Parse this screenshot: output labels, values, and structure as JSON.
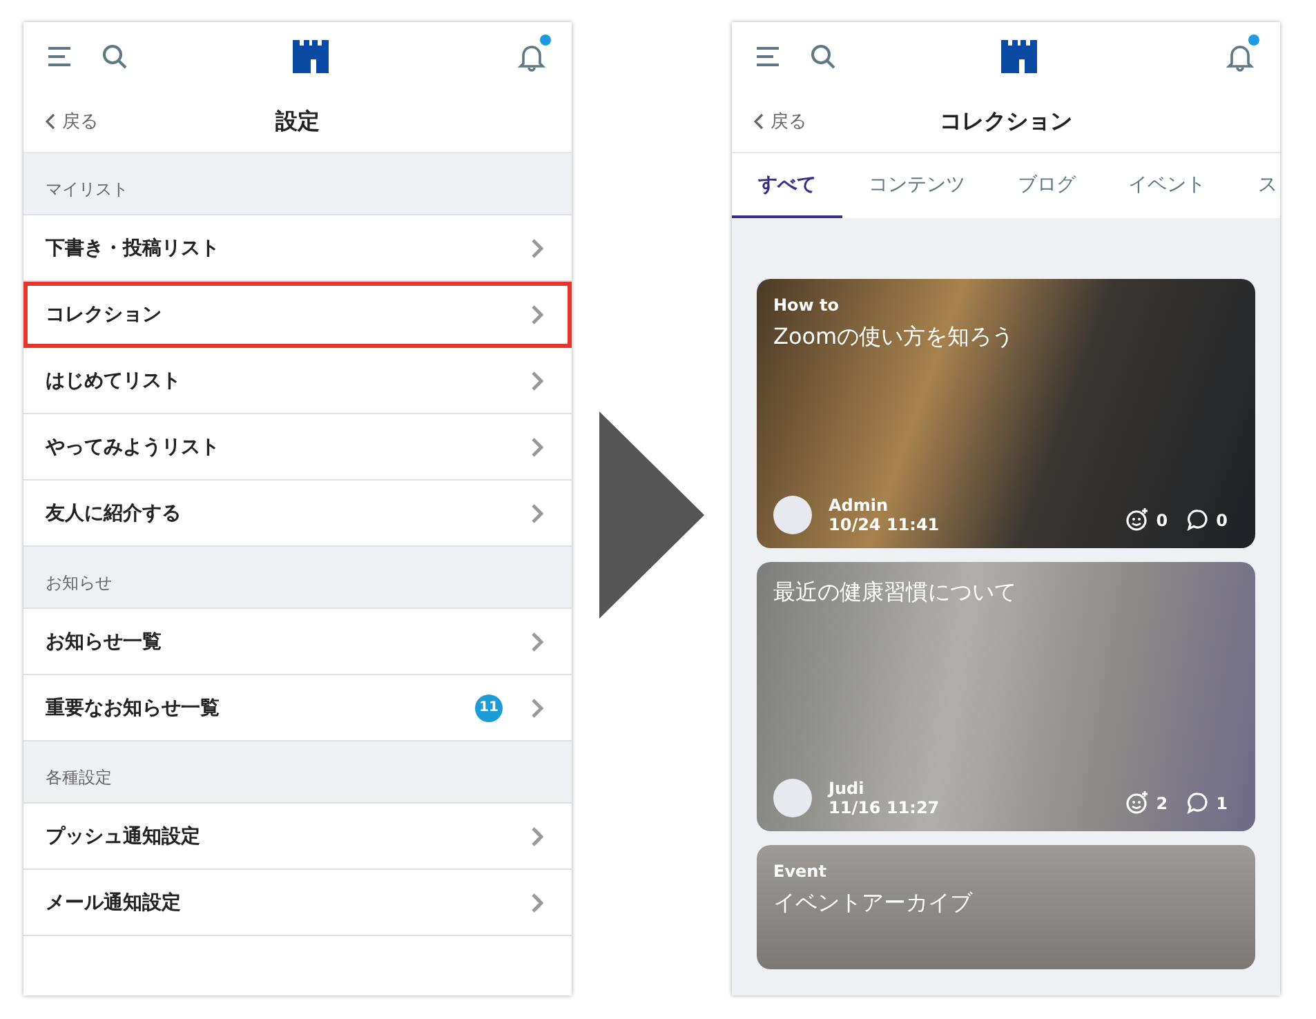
{
  "settings_screen": {
    "header": {
      "has_unread": true
    },
    "back": "戻る",
    "title": "設定",
    "sections": [
      {
        "heading": "マイリスト",
        "items": [
          {
            "label": "下書き・投稿リスト",
            "highlighted": false
          },
          {
            "label": "コレクション",
            "highlighted": true
          },
          {
            "label": "はじめてリスト",
            "highlighted": false
          },
          {
            "label": "やってみようリスト",
            "highlighted": false
          },
          {
            "label": "友人に紹介する",
            "highlighted": false
          }
        ]
      },
      {
        "heading": "お知らせ",
        "items": [
          {
            "label": "お知らせ一覧",
            "highlighted": false
          },
          {
            "label": "重要なお知らせ一覧",
            "highlighted": false,
            "badge": "11"
          }
        ]
      },
      {
        "heading": "各種設定",
        "items": [
          {
            "label": "プッシュ通知設定",
            "highlighted": false
          },
          {
            "label": "メール通知設定",
            "highlighted": false
          }
        ]
      }
    ]
  },
  "collection_screen": {
    "header": {
      "has_unread": true
    },
    "back": "戻る",
    "title": "コレクション",
    "tabs": [
      {
        "label": "すべて",
        "selected": true
      },
      {
        "label": "コンテンツ",
        "selected": false
      },
      {
        "label": "ブログ",
        "selected": false
      },
      {
        "label": "イベント",
        "selected": false
      },
      {
        "label": "ス",
        "selected": false
      }
    ],
    "cards": [
      {
        "category": "How to",
        "title": "Zoomの使い方を知ろう",
        "author": "Admin",
        "date": "10/24 11:41",
        "reactions": "0",
        "comments": "0",
        "kind": "laptop"
      },
      {
        "title": "最近の健康習慣について",
        "author": "Judi",
        "date": "11/16 11:27",
        "reactions": "2",
        "comments": "1",
        "kind": "doctor"
      },
      {
        "category": "Event",
        "title": "イベントアーカイブ",
        "kind": "event"
      }
    ]
  }
}
